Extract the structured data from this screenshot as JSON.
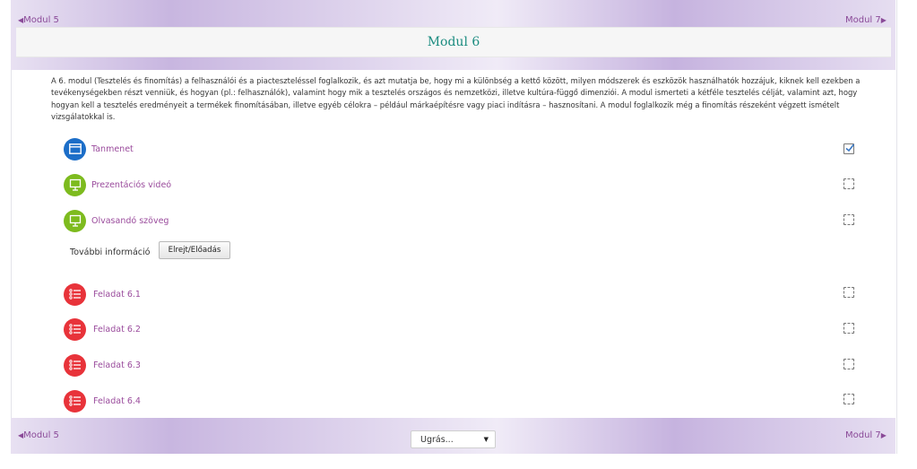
{
  "nav": {
    "prev_label": "Modul 5",
    "next_label": "Modul 7",
    "prev_icon": "triangle-left-icon",
    "next_icon": "triangle-right-icon"
  },
  "section": {
    "title": "Modul 6",
    "summary": "A 6. modul (Tesztelés és finomítás) a felhasználói és a piacteszteléssel foglalkozik, és azt mutatja be, hogy mi a különbség a kettő között, milyen módszerek és eszközök használhatók hozzájuk, kiknek kell ezekben a tevékenységekben részt venniük, és hogyan (pl.: felhasználók), valamint hogy mik a tesztelés országos és nemzetközi, illetve kultúra-függő dimenziói. A modul ismerteti a kétféle tesztelés célját, valamint azt, hogy hogyan kell a tesztelés eredményeit a termékek finomításában, illetve egyéb célokra – például márkaépítésre vagy piaci indításra – hasznosítani. A modul foglalkozik még a finomítás részeként végzett ismételt vizsgálatokkal is."
  },
  "activities": [
    {
      "label": "Tanmenet",
      "icon": "browser-window-icon",
      "color": "#1c6ec8",
      "completed": true
    },
    {
      "label": "Prezentációs videó",
      "icon": "presentation-board-icon",
      "color": "#7dbb1e",
      "completed": false
    },
    {
      "label": "Olvasandó szöveg",
      "icon": "presentation-board-icon",
      "color": "#7dbb1e",
      "completed": false
    },
    {
      "label": "Feladat 6.1",
      "icon": "checklist-icon",
      "color": "#e8333a",
      "completed": false
    },
    {
      "label": "Feladat 6.2",
      "icon": "checklist-icon",
      "color": "#e8333a",
      "completed": false
    },
    {
      "label": "Feladat 6.3",
      "icon": "checklist-icon",
      "color": "#e8333a",
      "completed": false
    },
    {
      "label": "Feladat 6.4",
      "icon": "checklist-icon",
      "color": "#e8333a",
      "completed": false
    }
  ],
  "more_info": {
    "label": "További információ",
    "button_label": "Elrejt/Előadás"
  },
  "jump_menu": {
    "selected": "Ugrás..."
  },
  "colors": {
    "accent_link": "#9a4b9c",
    "title": "#1b8c80"
  }
}
